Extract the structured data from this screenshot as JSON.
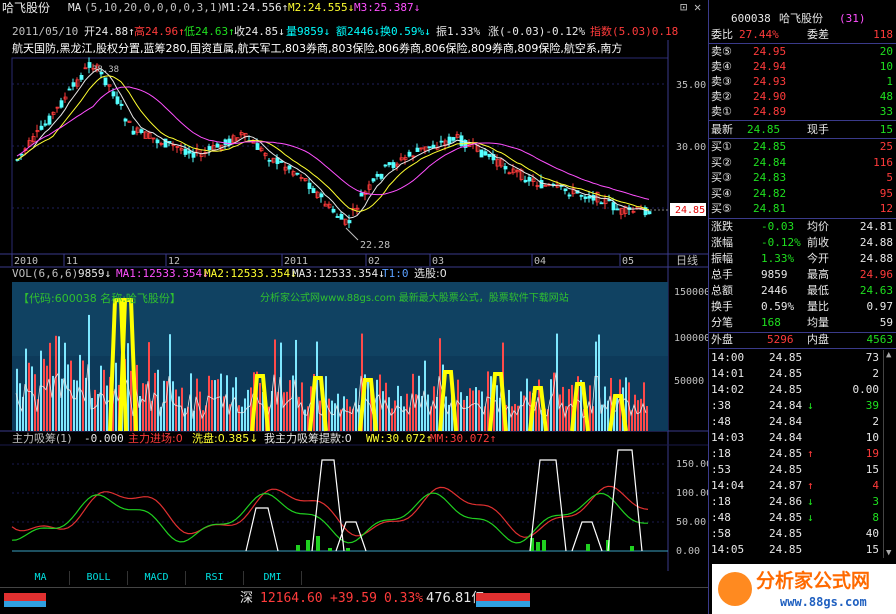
{
  "header": {
    "stock_name": "哈飞股份",
    "ma_label": "MA",
    "ma_params": "(5,10,20,0,0,0,0,3,1)",
    "m1": "M1:24.556↑",
    "m2": "M2:24.555↓",
    "m3": "M3:25.387↓",
    "date": "2011/05/10",
    "open": "开24.88↑",
    "high": "高24.96↑",
    "low": "低24.63↑",
    "close": "收24.85↓",
    "volume": "量9859↓",
    "amount": "额2446↓",
    "turnover": "换0.59%↓",
    "amplitude": "振1.33%",
    "change": "涨(-0.03)-0.12%",
    "index_label": "指数(5.03)0.18",
    "blocks": "航天国防,黑龙江,股权分置,蓝筹280,国资直属,航天军工,803券商,803保险,806券商,806保险,809券商,809保险,航空系,南方"
  },
  "main_chart": {
    "price_labels": [
      "35.00",
      "30.00",
      "25.00"
    ],
    "current_price": "24.85",
    "high_mark": "38.38",
    "low_mark": "22.28",
    "date_labels": [
      "2010",
      "11",
      "12",
      "2011",
      "02",
      "03",
      "04",
      "05"
    ],
    "date_axis_label": "日线"
  },
  "volume_chart": {
    "title": "VOL(6,6,6)",
    "value": "9859↓",
    "ma1": "MA1:12533.354↓",
    "ma2": "MA2:12533.354↓",
    "ma3": "MA3:12533.354↓",
    "t1": "T1:0",
    "pick": "选股:0",
    "code_text": "【代码:600038 名称:哈飞股份】",
    "ad_text": "分析家公式网www.88gs.com 最新最大股票公式，股票软件下载网站",
    "axis": [
      "150000",
      "100000",
      "50000"
    ]
  },
  "indicator_chart": {
    "title": "主力吸筹(1)",
    "value": "-0.000",
    "enter": "主力进场:0",
    "wash": "洗盘:0.385↓",
    "lift": "我主力吸筹提款:0",
    "ww": "WW:30.072↑",
    "mm": "MM:30.072↑",
    "axis": [
      "150.00",
      "100.00",
      "50.00",
      "0.00"
    ]
  },
  "tabs": [
    "MA",
    "BOLL",
    "MACD",
    "RSI",
    "DMI"
  ],
  "status_bar": {
    "market": "深",
    "index": "12164.60",
    "change": "+39.59",
    "pct": "0.33%",
    "amount": "476.81亿"
  },
  "quote_panel": {
    "code": "600038",
    "name": "哈飞股份",
    "num": "(31)",
    "weibi_label": "委比",
    "weibi_value": "27.44%",
    "weicha_label": "委差",
    "weicha_value": "118",
    "asks": [
      {
        "label": "卖⑤",
        "price": "24.95",
        "vol": "20"
      },
      {
        "label": "卖④",
        "price": "24.94",
        "vol": "10"
      },
      {
        "label": "卖③",
        "price": "24.93",
        "vol": "1"
      },
      {
        "label": "卖②",
        "price": "24.90",
        "vol": "48"
      },
      {
        "label": "卖①",
        "price": "24.89",
        "vol": "33"
      }
    ],
    "last_label": "最新",
    "last_value": "24.85",
    "xianshou_label": "现手",
    "xianshou_value": "15",
    "bids": [
      {
        "label": "买①",
        "price": "24.85",
        "vol": "25"
      },
      {
        "label": "买②",
        "price": "24.84",
        "vol": "116"
      },
      {
        "label": "买③",
        "price": "24.83",
        "vol": "5"
      },
      {
        "label": "买④",
        "price": "24.82",
        "vol": "95"
      },
      {
        "label": "买⑤",
        "price": "24.81",
        "vol": "12"
      }
    ],
    "stats": [
      {
        "l1": "涨跌",
        "v1": "-0.03",
        "l2": "均价",
        "v2": "24.81"
      },
      {
        "l1": "涨幅",
        "v1": "-0.12%",
        "l2": "前收",
        "v2": "24.88"
      },
      {
        "l1": "振幅",
        "v1": "1.33%",
        "l2": "今开",
        "v2": "24.88"
      },
      {
        "l1": "总手",
        "v1": "9859",
        "l2": "最高",
        "v2": "24.96"
      },
      {
        "l1": "总额",
        "v1": "2446",
        "l2": "最低",
        "v2": "24.63"
      },
      {
        "l1": "换手",
        "v1": "0.59%",
        "l2": "量比",
        "v2": "0.97"
      },
      {
        "l1": "分笔",
        "v1": "168",
        "l2": "均量",
        "v2": "59"
      }
    ],
    "outer_label": "外盘",
    "outer_value": "5296",
    "inner_label": "内盘",
    "inner_value": "4563",
    "ticks": [
      {
        "time": "14:00",
        "price": "24.85",
        "arrow": "",
        "vol": "73"
      },
      {
        "time": "14:01",
        "price": "24.85",
        "arrow": "",
        "vol": "2"
      },
      {
        "time": "14:02",
        "price": "24.85",
        "arrow": "",
        "vol": "0.00"
      },
      {
        "time": ":38",
        "price": "24.84",
        "arrow": "↓",
        "vol": "39"
      },
      {
        "time": ":48",
        "price": "24.84",
        "arrow": "",
        "vol": "2"
      },
      {
        "time": "14:03",
        "price": "24.84",
        "arrow": "",
        "vol": "10"
      },
      {
        "time": ":18",
        "price": "24.85",
        "arrow": "↑",
        "vol": "19"
      },
      {
        "time": ":53",
        "price": "24.85",
        "arrow": "",
        "vol": "15"
      },
      {
        "time": "14:04",
        "price": "24.87",
        "arrow": "↑",
        "vol": "4"
      },
      {
        "time": ":18",
        "price": "24.86",
        "arrow": "↓",
        "vol": "3"
      },
      {
        "time": ":48",
        "price": "24.85",
        "arrow": "↓",
        "vol": "8"
      },
      {
        "time": ":58",
        "price": "24.85",
        "arrow": "",
        "vol": "40"
      },
      {
        "time": "14:05",
        "price": "24.85",
        "arrow": "",
        "vol": "15"
      }
    ]
  },
  "watermark": {
    "brand": "分析家公式网",
    "url": "www.88gs.com"
  }
}
